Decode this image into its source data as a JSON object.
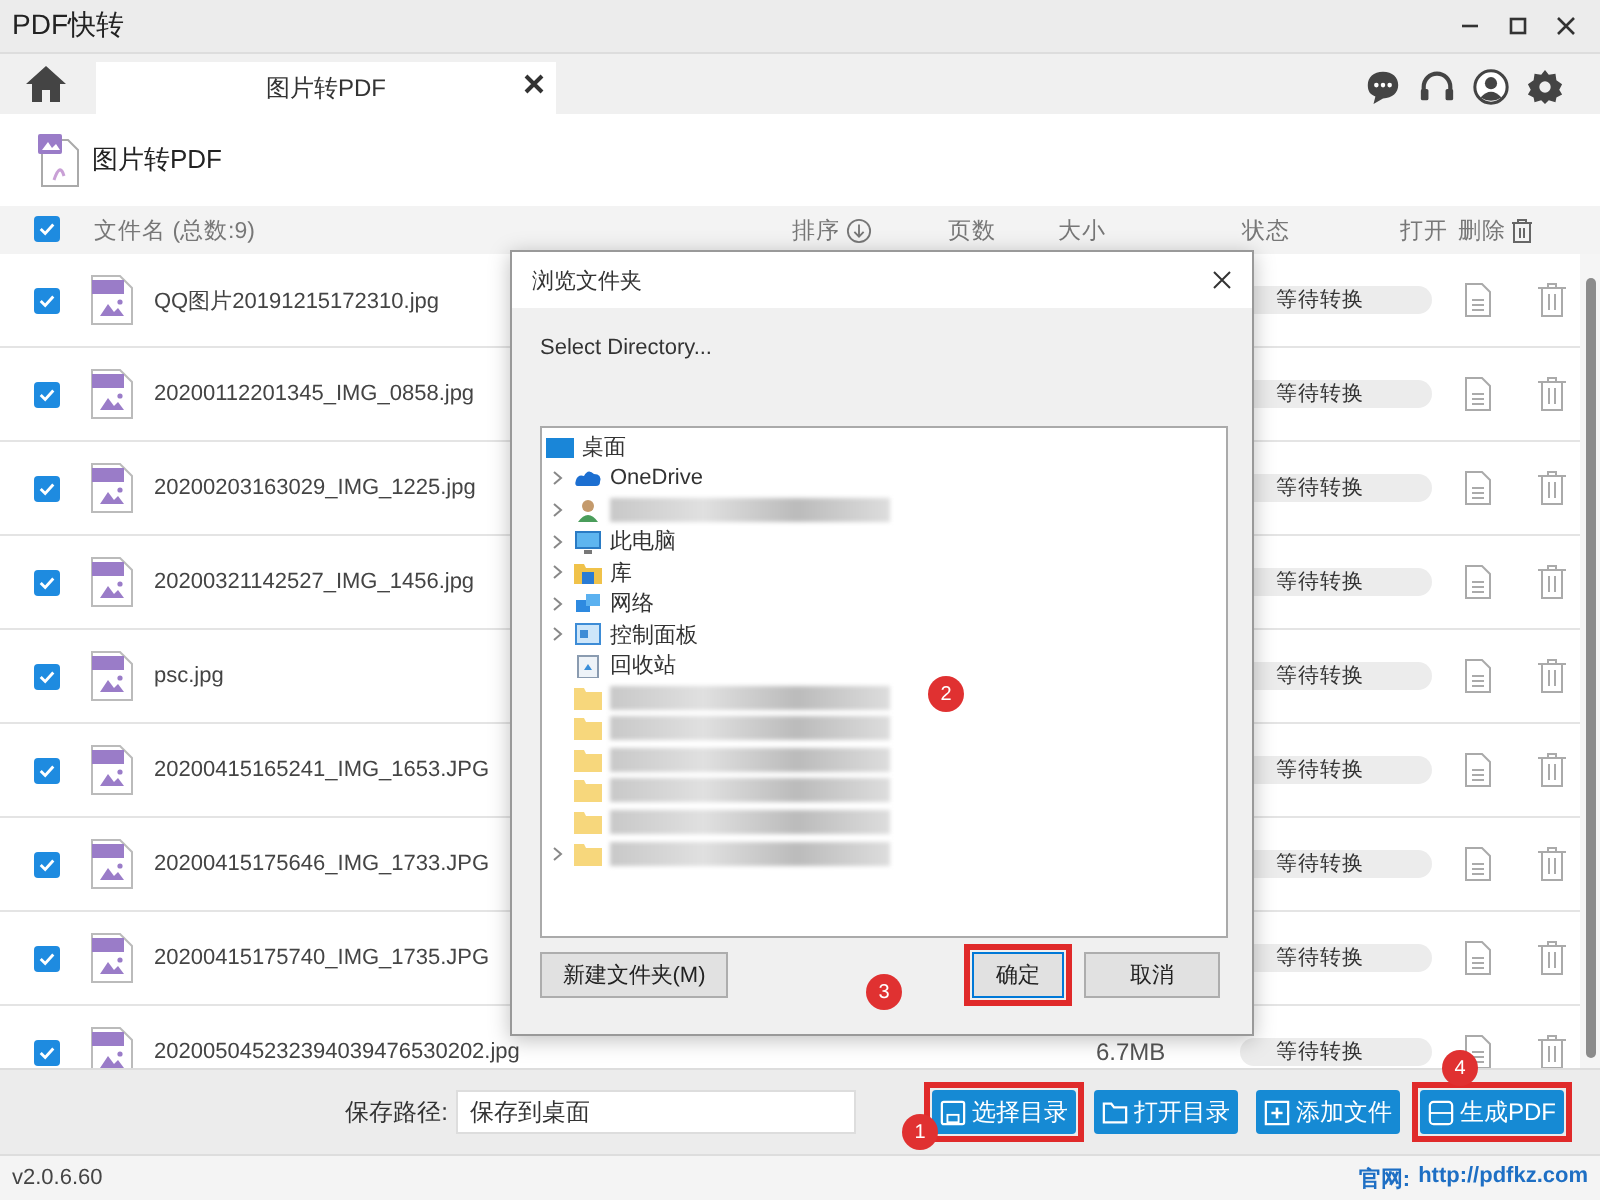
{
  "window": {
    "title": "PDF快转"
  },
  "tabs": [
    {
      "label": "图片转PDF",
      "selected": true
    }
  ],
  "header": {
    "title": "图片转PDF"
  },
  "columns": {
    "all_checked": true,
    "name": "文件名 (总数:9)",
    "sort": "排序",
    "pages": "页数",
    "size": "大小",
    "status": "状态",
    "open": "打开",
    "delete": "删除"
  },
  "rows": [
    {
      "name": "QQ图片20191215172310.jpg",
      "checked": true,
      "status": "等待转换"
    },
    {
      "name": "20200112201345_IMG_0858.jpg",
      "checked": true,
      "status": "等待转换"
    },
    {
      "name": "20200203163029_IMG_1225.jpg",
      "checked": true,
      "status": "等待转换"
    },
    {
      "name": "20200321142527_IMG_1456.jpg",
      "checked": true,
      "status": "等待转换"
    },
    {
      "name": "psc.jpg",
      "checked": true,
      "status": "等待转换"
    },
    {
      "name": "20200415165241_IMG_1653.JPG",
      "checked": true,
      "status": "等待转换"
    },
    {
      "name": "20200415175646_IMG_1733.JPG",
      "checked": true,
      "status": "等待转换"
    },
    {
      "name": "20200415175740_IMG_1735.JPG",
      "checked": true,
      "status": "等待转换"
    },
    {
      "name": "202005045232394039476530202.jpg",
      "checked": true,
      "status": "等待转换",
      "size": "6.7MB"
    }
  ],
  "save": {
    "label": "保存路径:",
    "value": "保存到桌面"
  },
  "buttons": [
    {
      "label": "选择目录",
      "kind": "save",
      "highlighted": true
    },
    {
      "label": "打开目录",
      "kind": "folder",
      "highlighted": false
    },
    {
      "label": "添加文件",
      "kind": "add",
      "highlighted": false
    },
    {
      "label": "生成PDF",
      "kind": "pdf",
      "highlighted": true
    }
  ],
  "status_bar": {
    "version": "v2.0.6.60",
    "site_label": "官网:",
    "site_url": "http://pdfkz.com"
  },
  "dialog": {
    "title": "浏览文件夹",
    "prompt": "Select Directory...",
    "tree": [
      {
        "label": "桌面",
        "kind": "desktop",
        "children": [
          {
            "label": "OneDrive",
            "kind": "cloud",
            "expandable": true
          },
          {
            "redacted": true,
            "kind": "user",
            "expandable": true
          },
          {
            "label": "此电脑",
            "kind": "computer",
            "expandable": true
          },
          {
            "label": "库",
            "kind": "library",
            "expandable": true
          },
          {
            "label": "网络",
            "kind": "network",
            "expandable": true
          },
          {
            "label": "控制面板",
            "kind": "control",
            "expandable": true
          },
          {
            "label": "回收站",
            "kind": "recycle",
            "expandable": false
          },
          {
            "redacted": true,
            "kind": "folder",
            "expandable": false
          },
          {
            "redacted": true,
            "kind": "folder",
            "expandable": false
          },
          {
            "redacted": true,
            "kind": "folder",
            "expandable": false
          },
          {
            "redacted": true,
            "kind": "folder",
            "expandable": false
          },
          {
            "redacted": true,
            "kind": "folder",
            "expandable": false
          },
          {
            "redacted": true,
            "kind": "folder",
            "expandable": true
          }
        ]
      }
    ],
    "buttons": [
      {
        "label": "新建文件夹(M)",
        "highlighted": false
      },
      {
        "label": "确定",
        "highlighted": true
      },
      {
        "label": "取消",
        "highlighted": false
      }
    ]
  },
  "annotations": [
    {
      "label": "1"
    },
    {
      "label": "2"
    },
    {
      "label": "3"
    },
    {
      "label": "4"
    }
  ]
}
